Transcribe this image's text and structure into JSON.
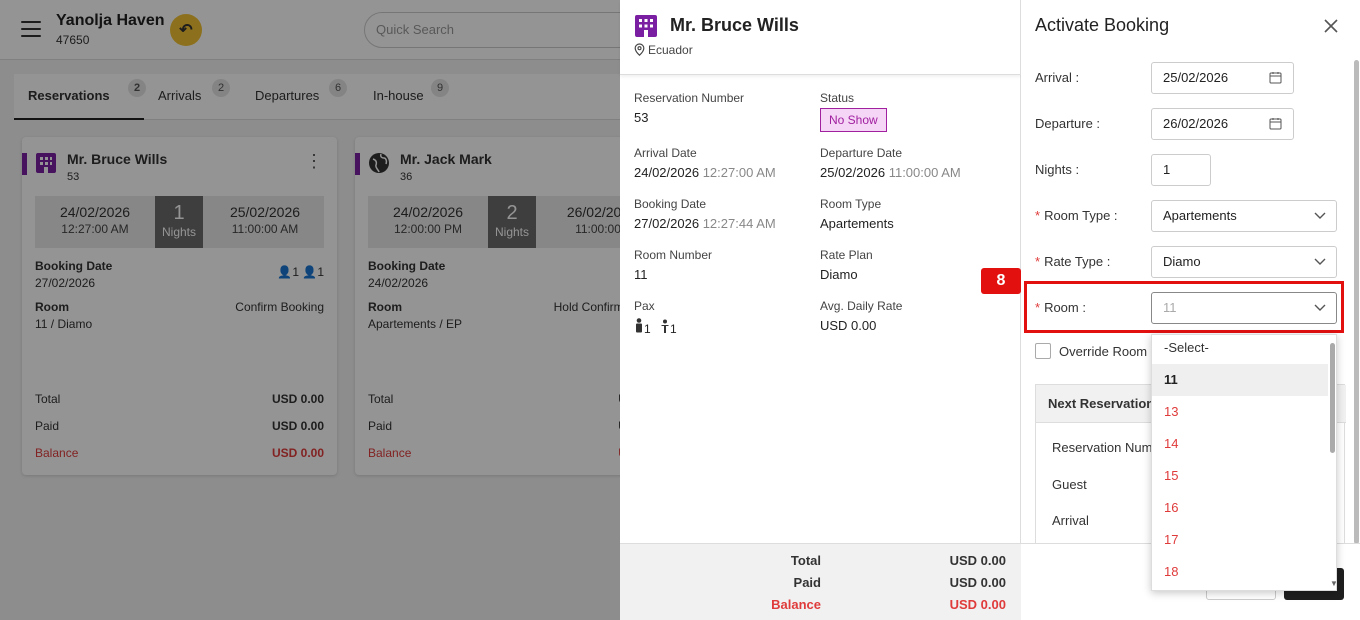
{
  "app": {
    "property_name": "Yanolja Haven",
    "property_code": "47650",
    "search_placeholder": "Quick Search"
  },
  "tabs": [
    {
      "label": "Reservations",
      "count": "2"
    },
    {
      "label": "Arrivals",
      "count": "2"
    },
    {
      "label": "Departures",
      "count": "6"
    },
    {
      "label": "In-house",
      "count": "9"
    }
  ],
  "cards": [
    {
      "guest": "Mr. Bruce Wills",
      "number": "53",
      "arrival_date": "24/02/2026",
      "arrival_time": "12:27:00 AM",
      "nights": "1",
      "nights_label": "Nights",
      "departure_date": "25/02/2026",
      "departure_time": "11:00:00 AM",
      "booking_date_label": "Booking Date",
      "booking_date": "27/02/2026",
      "adults": "1",
      "children": "1",
      "room_label": "Room",
      "room": "11 / Diamo",
      "action": "Confirm Booking",
      "total_label": "Total",
      "total": "USD 0.00",
      "paid_label": "Paid",
      "paid": "USD 0.00",
      "balance_label": "Balance",
      "balance": "USD 0.00"
    },
    {
      "guest": "Mr. Jack Mark",
      "number": "36",
      "arrival_date": "24/02/2026",
      "arrival_time": "12:00:00 PM",
      "nights": "2",
      "nights_label": "Nights",
      "departure_date": "26/02/202",
      "departure_time": "11:00:00",
      "booking_date_label": "Booking Date",
      "booking_date": "24/02/2026",
      "room_label": "Room",
      "room": "Apartements / EP",
      "action": "Hold Confirm B",
      "total_label": "Total",
      "total": "US",
      "paid_label": "Paid",
      "paid": "US",
      "balance_label": "Balance",
      "balance": "US"
    }
  ],
  "details": {
    "guest_name": "Mr. Bruce Wills",
    "location": "Ecuador",
    "reservation_number_label": "Reservation Number",
    "reservation_number": "53",
    "status_label": "Status",
    "status": "No Show",
    "arrival_date_label": "Arrival Date",
    "arrival_date": "24/02/2026",
    "arrival_time": "12:27:00 AM",
    "departure_date_label": "Departure Date",
    "departure_date": "25/02/2026",
    "departure_time": "11:00:00 AM",
    "booking_date_label": "Booking Date",
    "booking_date": "27/02/2026",
    "booking_time": "12:27:44 AM",
    "room_type_label": "Room Type",
    "room_type": "Apartements",
    "room_number_label": "Room Number",
    "room_number": "11",
    "rate_plan_label": "Rate Plan",
    "rate_plan": "Diamo",
    "pax_label": "Pax",
    "adults": "1",
    "children": "1",
    "adr_label": "Avg. Daily Rate",
    "adr": "USD 0.00",
    "total_label": "Total",
    "total": "USD 0.00",
    "paid_label": "Paid",
    "paid": "USD 0.00",
    "balance_label": "Balance",
    "balance": "USD 0.00"
  },
  "activate": {
    "title": "Activate Booking",
    "arrival_label": "Arrival",
    "arrival": "25/02/2026",
    "departure_label": "Departure",
    "departure": "26/02/2026",
    "nights_label": "Nights",
    "nights": "1",
    "room_type_label": "Room Type",
    "room_type": "Apartements",
    "rate_type_label": "Rate Type",
    "rate_type": "Diamo",
    "room_label": "Room",
    "room": "11",
    "override_label": "Override Room R",
    "next_title": "Next Reservation",
    "next_fields": [
      "Reservation Num",
      "Guest",
      "Arrival"
    ],
    "step_number": "8"
  },
  "room_dropdown": {
    "options": [
      "-Select-",
      "11",
      "13",
      "14",
      "15",
      "16",
      "17",
      "18"
    ],
    "selected": "11"
  },
  "colors": {
    "accent": "#7b1fa2",
    "no_show": "#a020a0",
    "balance_red": "#e03b3b",
    "highlight": "#e31010",
    "back_button": "#f1c232"
  }
}
